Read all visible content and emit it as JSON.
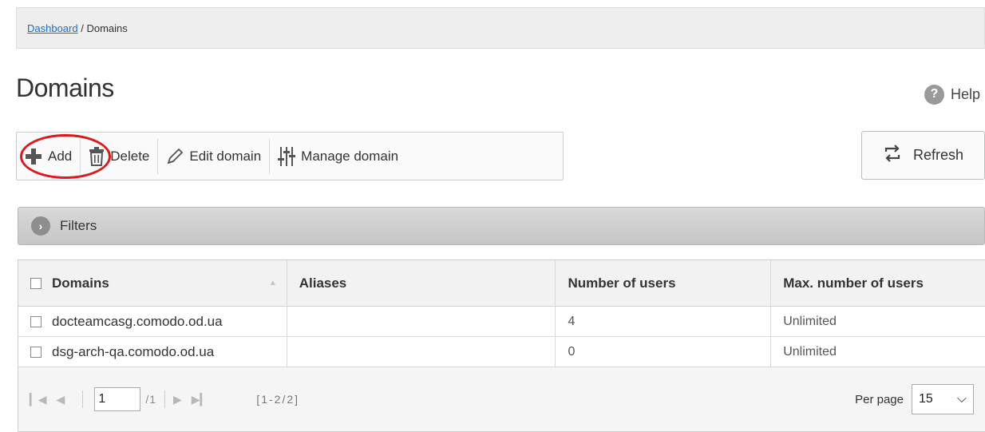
{
  "breadcrumb": {
    "link": "Dashboard",
    "separator": " / ",
    "current": "Domains"
  },
  "page_title": "Domains",
  "help_label": "Help",
  "toolbar": {
    "add": "Add",
    "delete": "Delete",
    "edit": "Edit domain",
    "manage": "Manage domain"
  },
  "refresh_label": "Refresh",
  "filters_label": "Filters",
  "table": {
    "headers": [
      "Domains",
      "Aliases",
      "Number of users",
      "Max. number of users"
    ],
    "rows": [
      {
        "domain": "docteamcasg.comodo.od.ua",
        "aliases": "",
        "users": "4",
        "max_users": "Unlimited"
      },
      {
        "domain": "dsg-arch-qa.comodo.od.ua",
        "aliases": "",
        "users": "0",
        "max_users": "Unlimited"
      }
    ]
  },
  "pager": {
    "page": "1",
    "total": "/1",
    "range": "[1-2/2]",
    "per_page_label": "Per page",
    "per_page_value": "15"
  },
  "icons": {
    "add": "plus-icon",
    "delete": "trash-icon",
    "edit": "pencil-icon",
    "manage": "sliders-icon",
    "refresh": "refresh-icon",
    "help": "help-icon",
    "filters": "chevron-right-icon"
  },
  "colors": {
    "highlight": "#e0171b",
    "link": "#1a6fc7",
    "filters_bar": "#cfcfcf"
  }
}
